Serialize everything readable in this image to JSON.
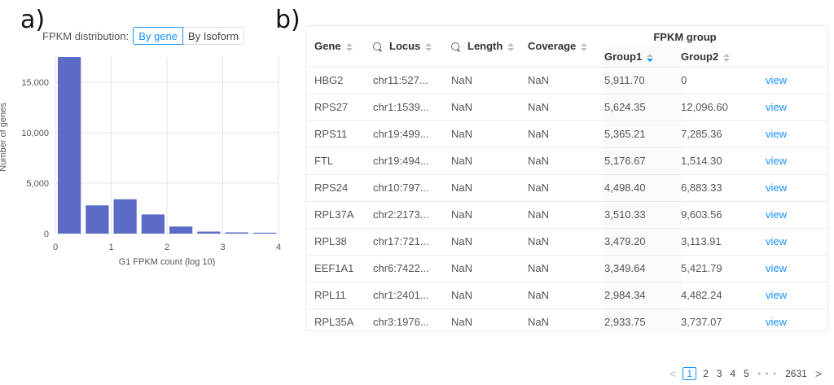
{
  "labels": {
    "a": "a)",
    "b": "b)"
  },
  "distribution": {
    "caption": "FPKM distribution:",
    "options": [
      "By gene",
      "By Isoform"
    ],
    "selected": "By gene"
  },
  "chart_data": {
    "type": "bar",
    "xlabel": "G1 FPKM count (log 10)",
    "ylabel": "Number of genes",
    "xlim": [
      0,
      4
    ],
    "ylim": [
      0,
      17500
    ],
    "xticks": [
      "0",
      "1",
      "2",
      "3",
      "4"
    ],
    "yticks": [
      "0",
      "5,000",
      "10,000",
      "15,000"
    ],
    "bin_edges": [
      0,
      0.5,
      1,
      1.5,
      2,
      2.5,
      3,
      3.5,
      4
    ],
    "values": [
      17500,
      2800,
      3400,
      1900,
      700,
      200,
      120,
      90
    ],
    "color": "#5b6bc6"
  },
  "table": {
    "headers": {
      "gene": "Gene",
      "locus": "Locus",
      "length": "Length",
      "coverage": "Coverage",
      "fpkm_group": "FPKM group",
      "group1": "Group1",
      "group2": "Group2"
    },
    "rows": [
      {
        "gene": "HBG2",
        "locus": "chr11:527...",
        "length": "NaN",
        "coverage": "NaN",
        "group1": "5,911.70",
        "group2": "0",
        "action": "view"
      },
      {
        "gene": "RPS27",
        "locus": "chr1:1539...",
        "length": "NaN",
        "coverage": "NaN",
        "group1": "5,624.35",
        "group2": "12,096.60",
        "action": "view"
      },
      {
        "gene": "RPS11",
        "locus": "chr19:499...",
        "length": "NaN",
        "coverage": "NaN",
        "group1": "5,365.21",
        "group2": "7,285.36",
        "action": "view"
      },
      {
        "gene": "FTL",
        "locus": "chr19:494...",
        "length": "NaN",
        "coverage": "NaN",
        "group1": "5,176.67",
        "group2": "1,514.30",
        "action": "view"
      },
      {
        "gene": "RPS24",
        "locus": "chr10:797...",
        "length": "NaN",
        "coverage": "NaN",
        "group1": "4,498.40",
        "group2": "6,883.33",
        "action": "view"
      },
      {
        "gene": "RPL37A",
        "locus": "chr2:2173...",
        "length": "NaN",
        "coverage": "NaN",
        "group1": "3,510.33",
        "group2": "9,603.56",
        "action": "view"
      },
      {
        "gene": "RPL38",
        "locus": "chr17:721...",
        "length": "NaN",
        "coverage": "NaN",
        "group1": "3,479.20",
        "group2": "3,113.91",
        "action": "view"
      },
      {
        "gene": "EEF1A1",
        "locus": "chr6:7422...",
        "length": "NaN",
        "coverage": "NaN",
        "group1": "3,349.64",
        "group2": "5,421.79",
        "action": "view"
      },
      {
        "gene": "RPL11",
        "locus": "chr1:2401...",
        "length": "NaN",
        "coverage": "NaN",
        "group1": "2,984.34",
        "group2": "4,482.24",
        "action": "view"
      },
      {
        "gene": "RPL35A",
        "locus": "chr3:1976...",
        "length": "NaN",
        "coverage": "NaN",
        "group1": "2,933.75",
        "group2": "3,737.07",
        "action": "view"
      }
    ]
  },
  "pagination": {
    "prev": "<",
    "pages": [
      "1",
      "2",
      "3",
      "4",
      "5"
    ],
    "current": "1",
    "ellipsis": "• • •",
    "last": "2631",
    "next": ">"
  },
  "icons": {
    "search": "search-icon",
    "sort": "sort-icon"
  },
  "colors": {
    "accent": "#1890ff",
    "bar": "#5b6bc6"
  }
}
